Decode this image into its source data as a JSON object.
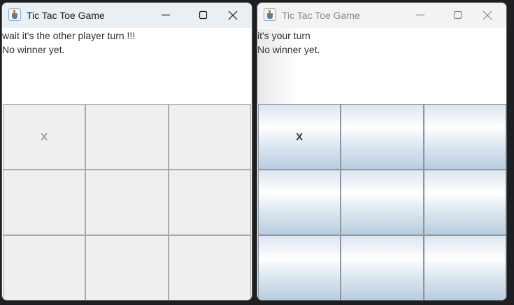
{
  "windows": [
    {
      "title": "Tic Tac Toe Game",
      "status_lines": [
        "wait it's the other player turn !!!",
        "No winner yet."
      ],
      "board": [
        "X",
        "",
        "",
        "",
        "",
        "",
        "",
        "",
        ""
      ]
    },
    {
      "title": "Tic Tac Toe Game",
      "status_lines": [
        "it's your turn",
        "No winner yet."
      ],
      "board": [
        "X",
        "",
        "",
        "",
        "",
        "",
        "",
        "",
        ""
      ]
    }
  ],
  "icons": {
    "app": "java-app-icon",
    "minimize": "minimize-icon",
    "maximize": "maximize-icon",
    "close": "close-icon"
  },
  "colors": {
    "active_titlebar": "#e8f0f5",
    "inactive_titlebar": "#f3f3f3",
    "cell_disabled": "#efefef",
    "cell_enabled_top": "#dbe5ef",
    "cell_enabled_bottom": "#b8cde0"
  }
}
